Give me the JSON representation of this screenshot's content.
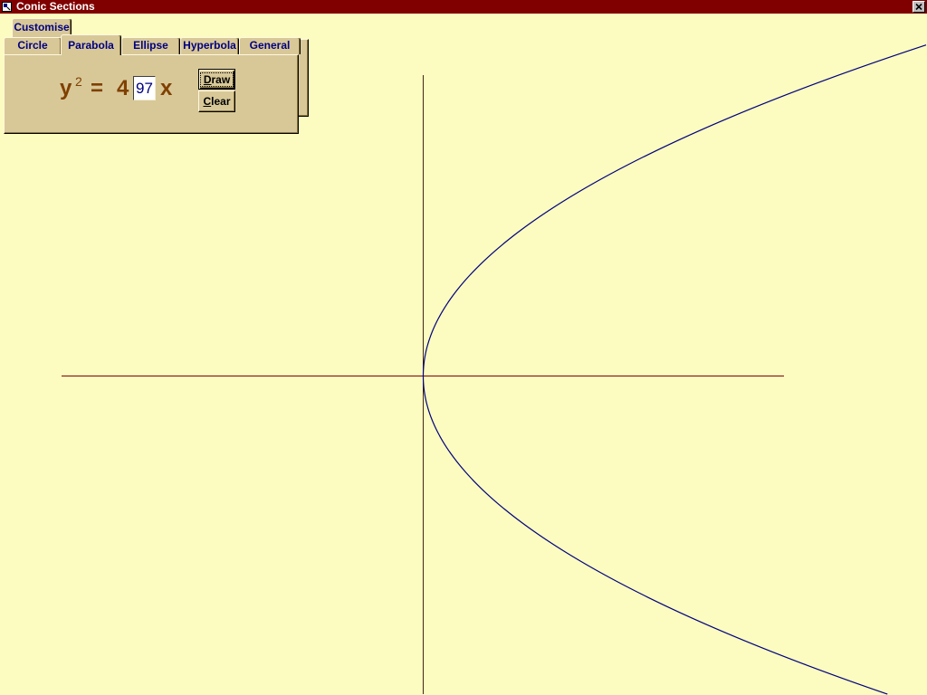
{
  "window": {
    "title": "Conic Sections",
    "app_icon": "app-icon",
    "close_icon": "close-icon"
  },
  "tabs": {
    "back_row": [
      {
        "label": "Customise"
      }
    ],
    "front_row": [
      {
        "label": "Circle",
        "selected": false
      },
      {
        "label": "Parabola",
        "selected": true
      },
      {
        "label": "Ellipse",
        "selected": false
      },
      {
        "label": "Hyperbola",
        "selected": false
      },
      {
        "label": "General",
        "selected": false
      }
    ]
  },
  "equation": {
    "lhs_variable": "y",
    "exponent": "2",
    "equals": "=",
    "coefficient": "4",
    "input_value": "97",
    "rhs_variable": "x"
  },
  "buttons": {
    "draw": "Draw",
    "clear": "Clear"
  },
  "colors": {
    "title_bar": "#800000",
    "canvas": "#FCFCC0",
    "panel": "#D8C898",
    "tab_text": "#000080",
    "equation_text": "#804000",
    "input_text": "#000080",
    "x_axis": "#800000",
    "y_axis": "#402818",
    "curve": "#000080"
  }
}
